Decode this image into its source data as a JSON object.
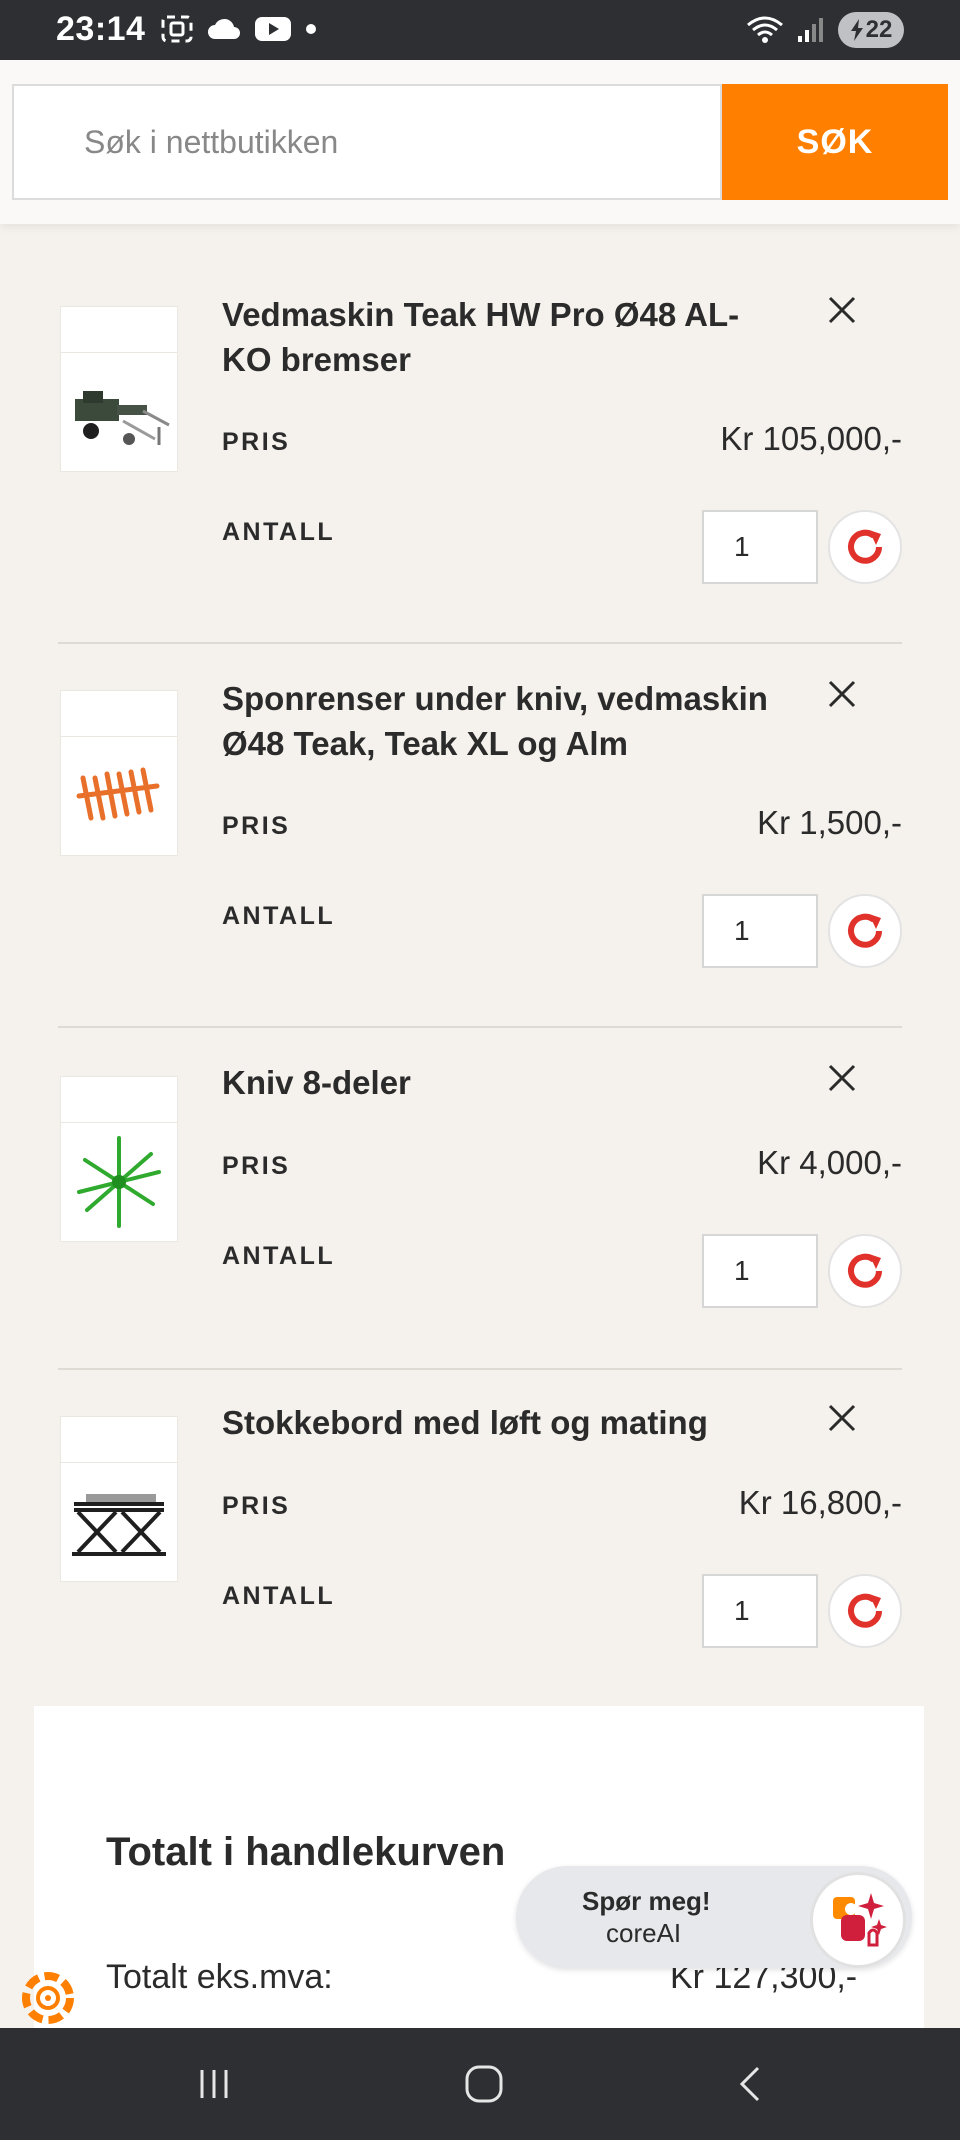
{
  "status_bar": {
    "time": "23:14",
    "battery": "22",
    "icons": [
      "screenshot-icon",
      "cloud-icon",
      "youtube-icon",
      "dot-icon",
      "wifi-icon",
      "signal-icon",
      "battery-icon"
    ]
  },
  "search": {
    "placeholder": "Søk i nettbutikken",
    "button_label": "SØK",
    "accent": "#ff7f00"
  },
  "cart": {
    "price_label": "PRIS",
    "qty_label": "ANTALL",
    "items": [
      {
        "title": "Vedmaskin Teak HW Pro Ø48 AL-KO bremser",
        "price": "Kr 105,000,-",
        "qty": "1",
        "image": "wood-processor-image"
      },
      {
        "title": "Sponrenser under kniv, vedmaskin Ø48 Teak, Teak XL og Alm",
        "price": "Kr 1,500,-",
        "qty": "1",
        "image": "chip-cleaner-image"
      },
      {
        "title": "Kniv 8-deler",
        "price": "Kr 4,000,-",
        "qty": "1",
        "image": "knife-8-part-image"
      },
      {
        "title": "Stokkebord med løft og mating",
        "price": "Kr 16,800,-",
        "qty": "1",
        "image": "log-table-image"
      }
    ]
  },
  "totals": {
    "title": "Totalt i handlekurven",
    "ex_vat_label": "Totalt eks.mva:",
    "ex_vat_value": "Kr 127,300,-"
  },
  "chat": {
    "line1": "Spør meg!",
    "line2": "coreAI"
  },
  "colors": {
    "accent": "#ff7f00",
    "refresh": "#e0312b",
    "page_bg": "#f5f1ec"
  }
}
